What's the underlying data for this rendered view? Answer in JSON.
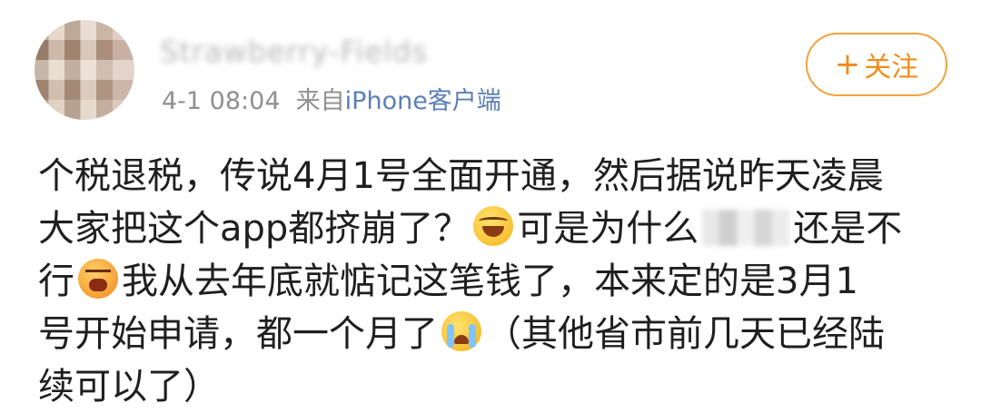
{
  "header": {
    "username": "Strawberry-Fields",
    "timestamp": "4-1 08:04",
    "source_prefix": "来自",
    "source_client": "iPhone客户端",
    "follow_icon": "+",
    "follow_label": "关注"
  },
  "post": {
    "line1": "个税退税，传说4月1号全面开通，然后据说昨天凌晨",
    "line2_a": "大家把这个app都挤崩了？",
    "line2_b": "可是为什么",
    "line2_c": "还是不",
    "line3_a": "行",
    "line3_b": "我从去年底就惦记这笔钱了，本来定的是3月1",
    "line4_a": "号开始申请，都一个月了",
    "line4_b": "（其他省市前几天已经陆",
    "line5": "续可以了）"
  },
  "emojis": {
    "laugh": "laugh-cry-emoji",
    "angry": "crying-loud-emoji",
    "cry": "tears-emoji"
  },
  "colors": {
    "accent": "#f08c18",
    "link": "#5b7fb5",
    "meta": "#8f8f8f"
  }
}
